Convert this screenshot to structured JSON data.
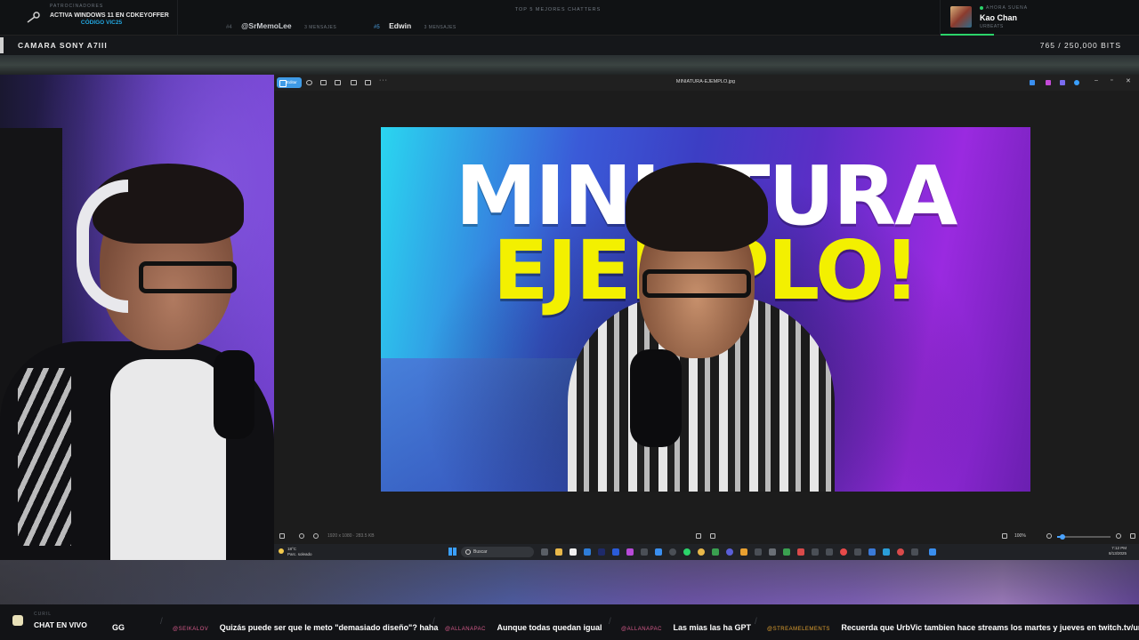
{
  "topbar": {
    "sponsor": {
      "label": "PATROCINADORES",
      "line1": "ACTIVA WINDOWS 11 EN CDKEYOFFER",
      "line2": "CÓDIGO VIC25"
    },
    "top_chatters": {
      "title": "TOP 5 MEJORES CHATTERS",
      "items": [
        {
          "rank": "#4",
          "name": "@SrMemoLee",
          "count": "3 MENSAJES"
        },
        {
          "rank": "#5",
          "name": "Edwin",
          "count": "3 MENSAJES"
        }
      ]
    },
    "now_playing": {
      "label": "AHORA SUENA",
      "title": "Kao Chan",
      "artist": "URBEATS"
    }
  },
  "camera_bar": {
    "label": "CAMARA SONY A7III",
    "bits": "765 / 250,000 BITS"
  },
  "photos_app": {
    "edit_label": "Editar",
    "filename": "MINIATURA-EJEMPLO.jpg",
    "thumbnail": {
      "line1": "MINIATURA",
      "line2": "EJEMPLO!"
    },
    "info": "1920 x 1080 · 283.5 KB",
    "zoom": "100%",
    "zoom_fraction": 0.1
  },
  "taskbar": {
    "weather_temp": "18°C",
    "weather_desc": "Parc. soleado",
    "search_placeholder": "Buscar",
    "time": "7:12 PM",
    "date": "8/13/2025"
  },
  "chat": {
    "sub": "CURIL",
    "label": "CHAT EN VIVO",
    "messages": [
      {
        "user": "",
        "text": "GG",
        "color": "#2bd46a"
      },
      {
        "user": "@SEIKALOV",
        "text": "Quizás puede ser que le meto \"demasiado diseño\"? haha",
        "color": "#d45a8a"
      },
      {
        "user": "@ALLANAPAC",
        "text": "Aunque todas quedan igual",
        "color": "#d45a8a"
      },
      {
        "user": "@ALLANAPAC",
        "text": "Las mias las ha GPT",
        "color": "#d45a8a"
      },
      {
        "user": "@STREAMELEMENTS",
        "text": "Recuerda que UrbVic tambien hace streams los martes y jueves en twitch.tv/urbvic",
        "color": "#e0a030"
      }
    ]
  }
}
